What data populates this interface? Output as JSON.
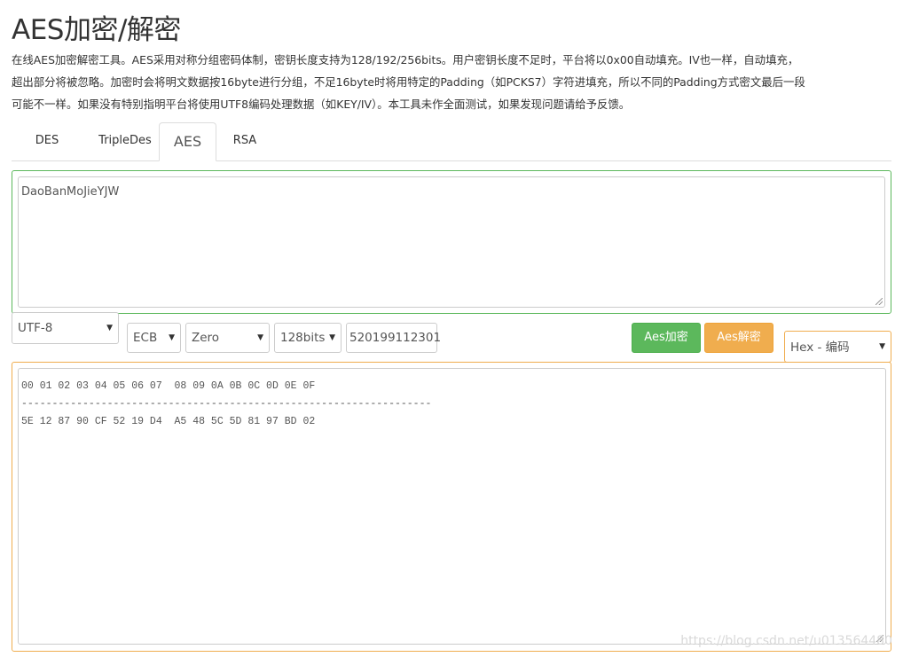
{
  "page": {
    "title": "AES加密/解密",
    "description_lines": [
      "在线AES加密解密工具。AES采用对称分组密码体制，密钥长度支持为128/192/256bits。用户密钥长度不足时，平台将以0x00自动填充。IV也一样，自动填充，",
      "超出部分将被忽略。加密时会将明文数据按16byte进行分组，不足16byte时将用特定的Padding（如PCKS7）字符进填充，所以不同的Padding方式密文最后一段",
      "可能不一样。如果没有特别指明平台将使用UTF8编码处理数据（如KEY/IV）。本工具未作全面测试，如果发现问题请给予反馈。"
    ]
  },
  "tabs": [
    {
      "label": "DES",
      "active": false
    },
    {
      "label": "TripleDes",
      "active": false
    },
    {
      "label": "AES",
      "active": true
    },
    {
      "label": "RSA",
      "active": false
    }
  ],
  "input": {
    "value": "DaoBanMoJieYJW"
  },
  "controls": {
    "encoding": "UTF-8",
    "mode": "ECB",
    "padding": "Zero",
    "key_size": "128bits",
    "key_value": "520199112301",
    "encrypt_label": "Aes加密",
    "decrypt_label": "Aes解密",
    "output_format": "Hex - 编码"
  },
  "output": {
    "lines": [
      "00 01 02 03 04 05 06 07  08 09 0A 0B 0C 0D 0E 0F",
      "-------------------------------------------------------------------",
      "5E 12 87 90 CF 52 19 D4  A5 48 5C 5D 81 97 BD 02"
    ]
  },
  "watermark": "https://blog.csdn.net/u013564480",
  "colors": {
    "success_green": "#5cb85c",
    "warning_orange": "#f0ad4e",
    "border_gray": "#cccccc"
  }
}
